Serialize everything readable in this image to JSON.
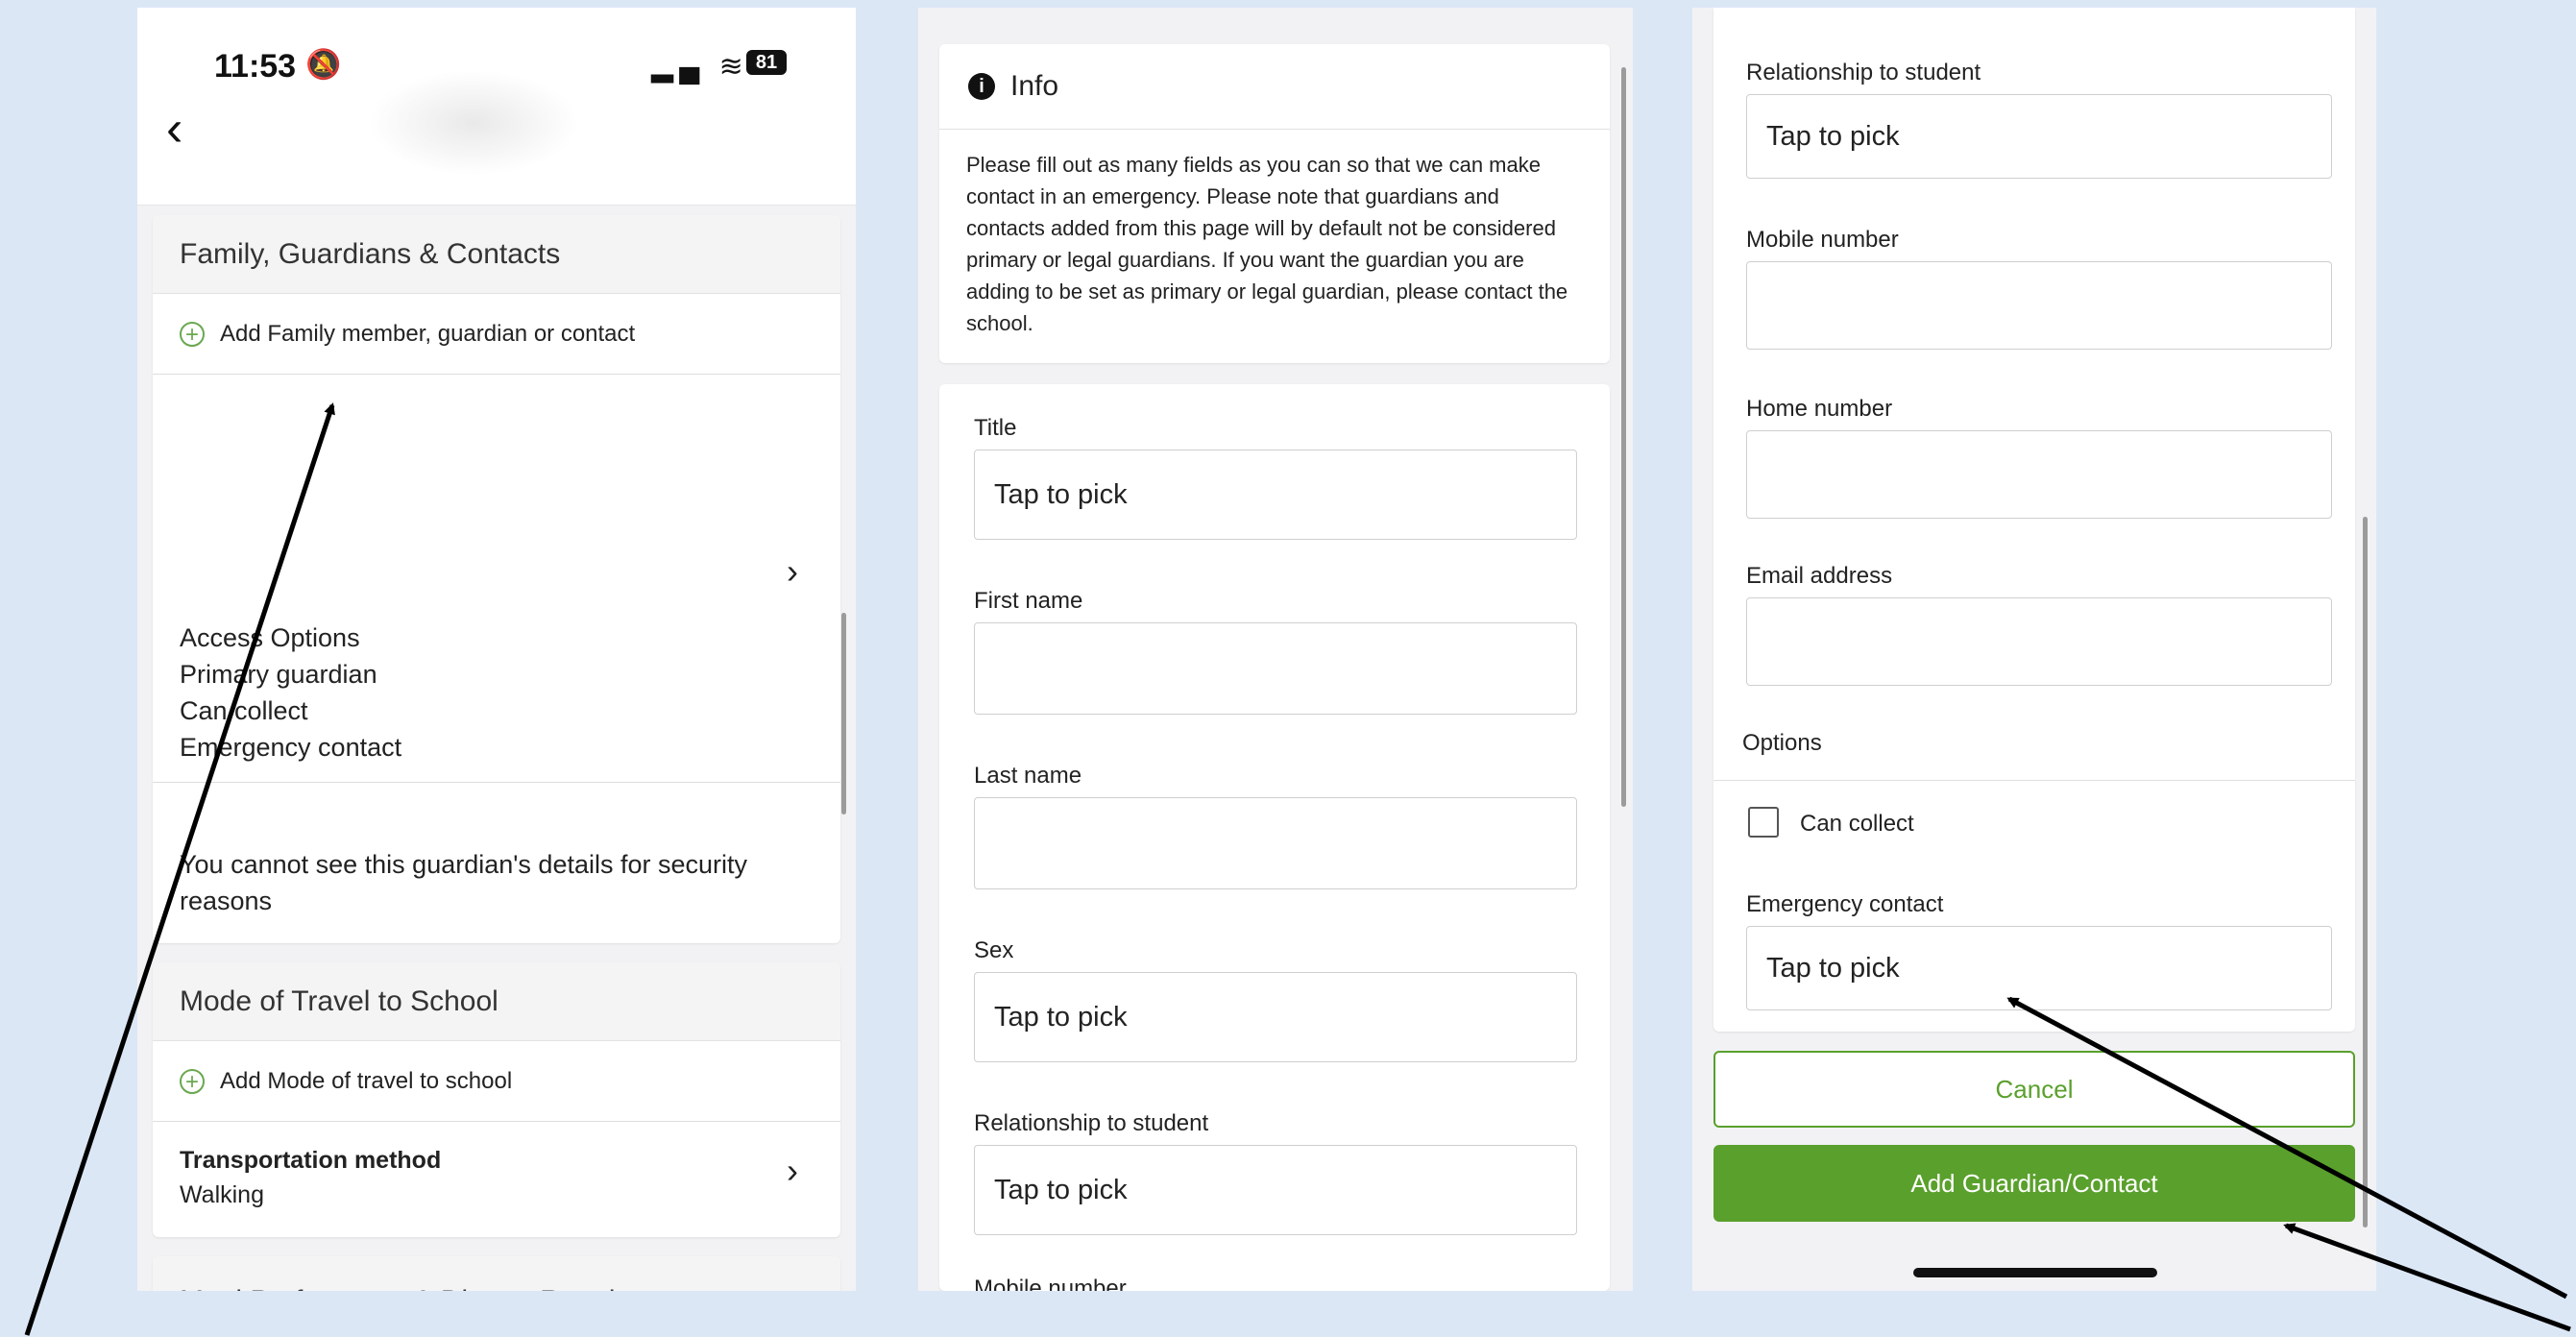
{
  "phone1": {
    "status_time": "11:53",
    "battery": "81",
    "family_section": {
      "title": "Family, Guardians & Contacts",
      "add_label": "Add Family member, guardian or contact",
      "access_lines": [
        "Access Options",
        "Primary guardian",
        "Can collect",
        "Emergency contact"
      ],
      "security_note": "You cannot see this guardian's details for security reasons"
    },
    "travel_section": {
      "title": "Mode of Travel to School",
      "add_label": "Add Mode of travel to school",
      "item_title": "Transportation method",
      "item_value": "Walking"
    },
    "next_section_partial": "Meal Preferences & Dietary Requirements"
  },
  "phone2": {
    "info_title": "Info",
    "info_text": "Please fill out as many fields as you can so that we can make contact in an emergency. Please note that guardians and contacts added from this page will by default not be considered primary or legal guardians. If you want the guardian you are adding to be set as primary or legal guardian, please contact the school.",
    "fields": {
      "title_label": "Title",
      "title_value": "Tap to pick",
      "first_name_label": "First name",
      "first_name_value": "",
      "last_name_label": "Last name",
      "last_name_value": "",
      "sex_label": "Sex",
      "sex_value": "Tap to pick",
      "relationship_label": "Relationship to student",
      "relationship_value": "Tap to pick",
      "mobile_label": "Mobile number"
    }
  },
  "phone3": {
    "relationship_label": "Relationship to student",
    "relationship_value": "Tap to pick",
    "mobile_label": "Mobile number",
    "mobile_value": "",
    "home_label": "Home number",
    "home_value": "",
    "email_label": "Email address",
    "email_value": "",
    "options_label": "Options",
    "can_collect_label": "Can collect",
    "emergency_label": "Emergency contact",
    "emergency_value": "Tap to pick",
    "cancel_label": "Cancel",
    "submit_label": "Add Guardian/Contact",
    "accent_color": "#5aa02c"
  }
}
